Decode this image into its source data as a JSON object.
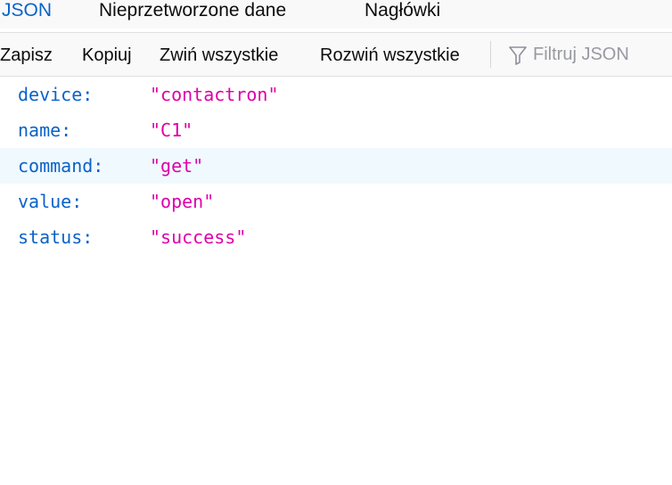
{
  "tabs": {
    "json": "JSON",
    "raw": "Nieprzetworzone dane",
    "headers": "Nagłówki"
  },
  "toolbar": {
    "save": "Zapisz",
    "copy": "Kopiuj",
    "collapse_all": "Zwiń wszystkie",
    "expand_all": "Rozwiń wszystkie",
    "filter_placeholder": "Filtruj JSON",
    "filter_icon": "funnel-icon"
  },
  "json": {
    "rows": [
      {
        "key": "device:",
        "value": "\"contactron\""
      },
      {
        "key": "name:",
        "value": "\"C1\""
      },
      {
        "key": "command:",
        "value": "\"get\""
      },
      {
        "key": "value:",
        "value": "\"open\""
      },
      {
        "key": "status:",
        "value": "\"success\""
      }
    ]
  },
  "colors": {
    "accent": "#0a62c9",
    "string": "#dd00a9",
    "hover_row": "#f0f9fe"
  }
}
